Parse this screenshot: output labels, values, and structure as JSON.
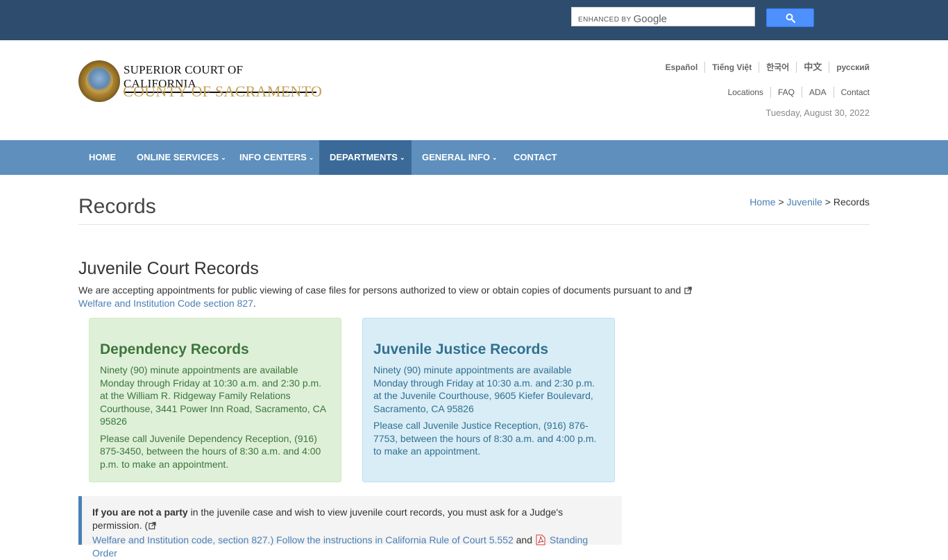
{
  "search": {
    "brand_prefix": "ENHANCED BY",
    "brand_name": "Google"
  },
  "header": {
    "court_line1": "SUPERIOR COURT OF CALIFORNIA",
    "court_line2": "COUNTY OF SACRAMENTO",
    "languages": [
      "Español",
      "Tiếng Việt",
      "한국어",
      "中文",
      "русский"
    ],
    "utility_links": [
      "Locations",
      "FAQ",
      "ADA",
      "Contact"
    ],
    "date": "Tuesday, August 30, 2022"
  },
  "nav": {
    "items": [
      {
        "label": "HOME"
      },
      {
        "label": "ONLINE SERVICES"
      },
      {
        "label": "INFO CENTERS"
      },
      {
        "label": "DEPARTMENTS"
      },
      {
        "label": "GENERAL INFO"
      },
      {
        "label": "CONTACT"
      }
    ]
  },
  "page": {
    "title": "Records",
    "breadcrumb": {
      "home": "Home",
      "sep": ">",
      "parent": "Juvenile",
      "current": "Records"
    }
  },
  "section": {
    "title": "Juvenile Court Records",
    "intro_text": "We are accepting appointments for public viewing of case files for persons authorized to view or obtain copies of documents pursuant to and",
    "intro_link": "Welfare and Institution Code section 827",
    "intro_end": "."
  },
  "cards": {
    "dependency": {
      "title": "Dependency Records",
      "p1": "Ninety (90) minute appointments are available Monday through Friday at 10:30 a.m. and 2:30 p.m. at the William R. Ridgeway Family Relations Courthouse, 3441 Power Inn Road, Sacramento, CA 95826",
      "p2": "Please call Juvenile Dependency Reception, (916) 875-3450, between the hours of 8:30 a.m. and 4:00 p.m. to make an appointment."
    },
    "justice": {
      "title": "Juvenile Justice Records",
      "p1": "Ninety (90) minute appointments are available Monday through Friday at 10:30 a.m. and 2:30 p.m. at the Juvenile Courthouse, 9605 Kiefer Boulevard, Sacramento, CA 95826",
      "p2": "Please call Juvenile Justice Reception, (916) 876-7753, between the hours of 8:30 a.m. and 4:00 p.m. to make an appointment."
    }
  },
  "note": {
    "bold": "If you are not a party",
    "text": " in the juvenile case and wish to view juvenile court records, you must ask for a Judge's permission. (",
    "link1": "Welfare and Institution code, section 827.)",
    "link2": " Follow the instructions in California Rule of Court 5.552",
    "and": " and ",
    "link3": "Standing Order"
  }
}
